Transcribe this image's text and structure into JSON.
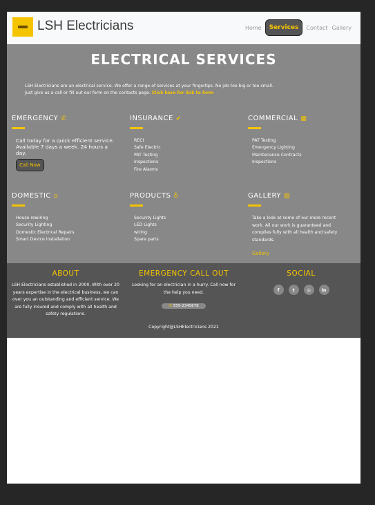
{
  "header": {
    "brand": "LSH Electricians",
    "nav": [
      {
        "label": "Home"
      },
      {
        "label": "Services"
      },
      {
        "label": "Contact"
      },
      {
        "label": "Gallery"
      }
    ]
  },
  "services": {
    "title": "ELECTRICAL SERVICES",
    "intro_line1": "LSH Electricians are an electrical service. We offer a range of services at your fingertips. No job too big or too small.",
    "intro_line2": "Just give us a call or fill out our form on the contacts page.",
    "intro_link": "Click here for link to form",
    "emergency": {
      "heading": "EMERGENCY",
      "icon": "phone-icon",
      "text": "Call today for a quick efficient service. Available 7 days a week. 24 hours a day.",
      "button": "Call Now"
    },
    "insurance": {
      "heading": "INSURANCE",
      "icon": "check-icon",
      "items": [
        "RECI",
        "Safe Electric",
        "PAT Testing",
        "Inspections",
        "Fire Alarms"
      ]
    },
    "commercial": {
      "heading": "COMMERCIAL",
      "icon": "building-icon",
      "items": [
        "PAT Testing",
        "Emergency Lighting",
        "Maintenance Contracts",
        "Inspections"
      ]
    },
    "domestic": {
      "heading": "DOMESTIC",
      "icon": "home-icon",
      "items": [
        "House rewiring",
        "Security Lighting",
        "Domestic Electrical Repairs",
        "Smart Device Installation"
      ]
    },
    "products": {
      "heading": "PRODUCTS",
      "icon": "lightbulb-icon",
      "items": [
        "Security Lights",
        "LED Lights",
        "wiring",
        "Spare parts"
      ]
    },
    "gallery": {
      "heading": "GALLERY",
      "icon": "image-icon",
      "text": "Take a look at some of our more recent work. All our work is guaranteed and complies fully with all health and safety standards.",
      "link": "Gallery"
    }
  },
  "footer": {
    "about": {
      "heading": "ABOUT",
      "text": "LSH Electricians established in 2000. With over 20 years expertise in the electrical business, we can over you an outstanding and efficient service. We are fully insured and comply with all health and safety regulations."
    },
    "emergency": {
      "heading": "EMERGENCY CALL OUT",
      "text": "Looking for an electrician in a hurry. Call now for the help you need.",
      "phone": "555-2345678"
    },
    "social": {
      "heading": "SOCIAL",
      "icons": [
        {
          "name": "facebook-icon",
          "glyph": "f"
        },
        {
          "name": "twitter-icon",
          "glyph": "t"
        },
        {
          "name": "instagram-icon",
          "glyph": "◎"
        },
        {
          "name": "linkedin-icon",
          "glyph": "in"
        }
      ]
    },
    "copyright": "Copyright@LSHElectricians 2021"
  },
  "colors": {
    "accent": "#f5c400",
    "services_bg": "#888888",
    "footer_bg": "#555555",
    "frame_bg": "#262626"
  }
}
